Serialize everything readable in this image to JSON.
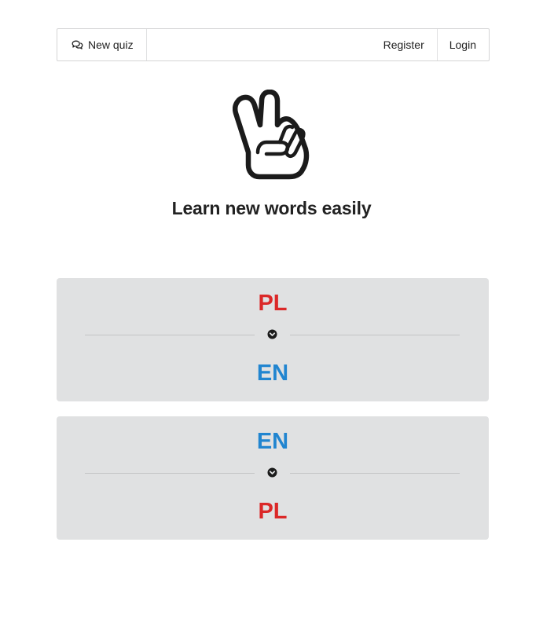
{
  "menu": {
    "new_quiz_label": "New quiz",
    "new_quiz_icon": "chat-icon",
    "register_label": "Register",
    "login_label": "Login"
  },
  "hero": {
    "logo_icon": "peace-hand-icon",
    "tagline": "Learn new words easily"
  },
  "quiz_directions": [
    {
      "from": "PL",
      "to": "EN",
      "arrow_icon": "chevron-down-circle-icon"
    },
    {
      "from": "EN",
      "to": "PL",
      "arrow_icon": "chevron-down-circle-icon"
    }
  ],
  "colors": {
    "pl": "#db2828",
    "en": "#2185d0",
    "card_bg": "#e0e1e2"
  }
}
